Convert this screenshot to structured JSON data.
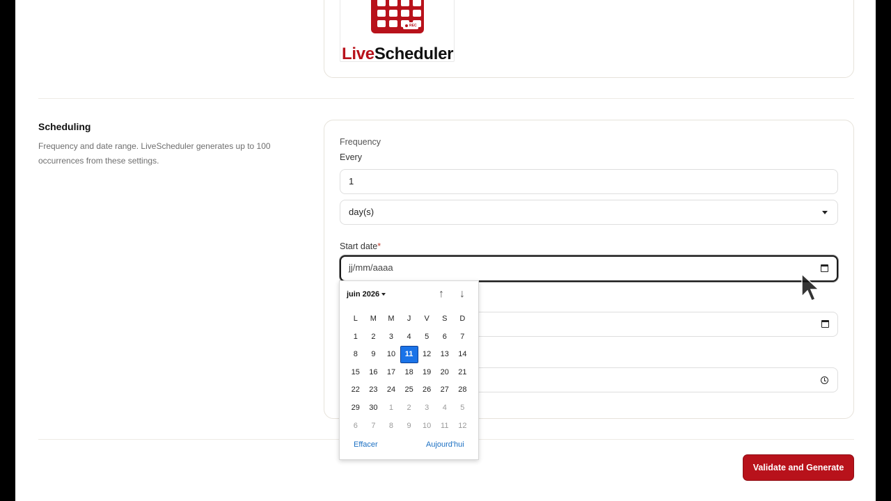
{
  "logo": {
    "text_live": "Live",
    "text_scheduler": "Scheduler",
    "badge": "REC"
  },
  "scheduling": {
    "title": "Scheduling",
    "description": "Frequency and date range. LiveScheduler generates up to 100 occurrences from these settings."
  },
  "form": {
    "frequency_label": "Frequency",
    "every_label": "Every",
    "every_value": "1",
    "unit_value": "day(s)",
    "start_date_label": "Start date",
    "required_mark": "*",
    "start_date_placeholder": "jj/mm/aaaa"
  },
  "calendar": {
    "month_label": "juin 2026",
    "nav_up": "↑",
    "nav_down": "↓",
    "weekdays": [
      "L",
      "M",
      "M",
      "J",
      "V",
      "S",
      "D"
    ],
    "selected_day": "11",
    "weeks": [
      [
        {
          "d": "1"
        },
        {
          "d": "2"
        },
        {
          "d": "3"
        },
        {
          "d": "4"
        },
        {
          "d": "5"
        },
        {
          "d": "6"
        },
        {
          "d": "7"
        }
      ],
      [
        {
          "d": "8"
        },
        {
          "d": "9"
        },
        {
          "d": "10"
        },
        {
          "d": "11",
          "sel": true
        },
        {
          "d": "12"
        },
        {
          "d": "13"
        },
        {
          "d": "14"
        }
      ],
      [
        {
          "d": "15"
        },
        {
          "d": "16"
        },
        {
          "d": "17"
        },
        {
          "d": "18"
        },
        {
          "d": "19"
        },
        {
          "d": "20"
        },
        {
          "d": "21"
        }
      ],
      [
        {
          "d": "22"
        },
        {
          "d": "23"
        },
        {
          "d": "24"
        },
        {
          "d": "25"
        },
        {
          "d": "26"
        },
        {
          "d": "27"
        },
        {
          "d": "28"
        }
      ],
      [
        {
          "d": "29"
        },
        {
          "d": "30"
        },
        {
          "d": "1",
          "o": true
        },
        {
          "d": "2",
          "o": true
        },
        {
          "d": "3",
          "o": true
        },
        {
          "d": "4",
          "o": true
        },
        {
          "d": "5",
          "o": true
        }
      ],
      [
        {
          "d": "6",
          "o": true
        },
        {
          "d": "7",
          "o": true
        },
        {
          "d": "8",
          "o": true
        },
        {
          "d": "9",
          "o": true
        },
        {
          "d": "10",
          "o": true
        },
        {
          "d": "11",
          "o": true
        },
        {
          "d": "12",
          "o": true
        }
      ]
    ],
    "clear_label": "Effacer",
    "today_label": "Aujourd'hui"
  },
  "actions": {
    "submit_label": "Validate and Generate"
  },
  "colors": {
    "brand": "#b8121b",
    "selected_day": "#1a73e8",
    "link": "#1a6fc2"
  }
}
